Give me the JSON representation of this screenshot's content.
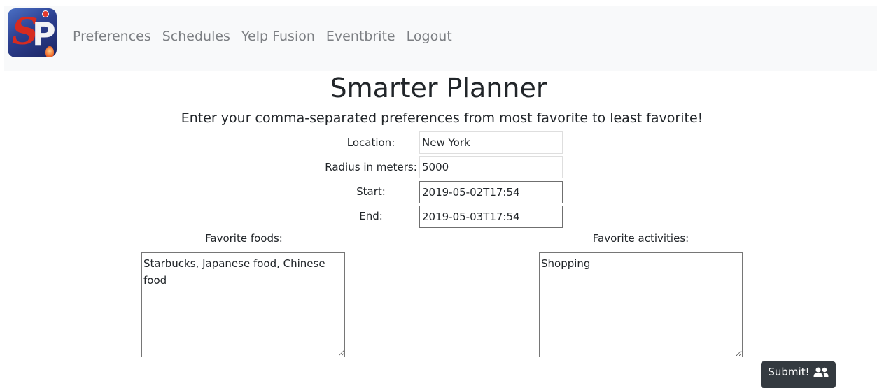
{
  "nav": {
    "logo_letters": [
      "S",
      "P"
    ],
    "links": [
      "Preferences",
      "Schedules",
      "Yelp Fusion",
      "Eventbrite",
      "Logout"
    ]
  },
  "title": "Smarter Planner",
  "subtitle": "Enter your comma-separated preferences from most favorite to least favorite!",
  "form": {
    "location": {
      "label": "Location:",
      "value": "New York"
    },
    "radius": {
      "label": "Radius in meters:",
      "value": "5000"
    },
    "start": {
      "label": "Start:",
      "value": "2019-05-02T17:54"
    },
    "end": {
      "label": "End:",
      "value": "2019-05-03T17:54"
    },
    "foods": {
      "label": "Favorite foods:",
      "value": "Starbucks, Japanese food, Chinese food"
    },
    "activities": {
      "label": "Favorite activities:",
      "value": "Shopping"
    },
    "submit_label": "Submit!",
    "submit_icon": "users-icon"
  },
  "colors": {
    "navbar_bg": "#f8f9fa",
    "nav_link": "#7c7f83",
    "button_bg": "#343a40"
  }
}
